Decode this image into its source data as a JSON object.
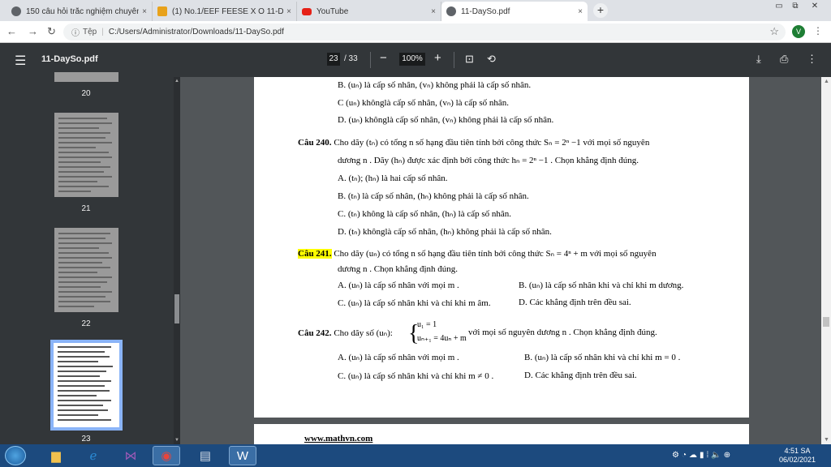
{
  "tabs": [
    {
      "title": "150 câu hỏi trắc nghiệm chuyên",
      "close": "×"
    },
    {
      "title": "(1) No.1/EEF FEESE X O 11-DaySo",
      "close": "×"
    },
    {
      "title": "YouTube",
      "close": "×"
    },
    {
      "title": "11-DaySo.pdf",
      "close": "×"
    }
  ],
  "new_tab": "+",
  "window_controls": {
    "minimize": "▭",
    "restore": "⧉",
    "close": "✕"
  },
  "address": {
    "scheme": "Tệp",
    "url": "C:/Users/Administrator/Downloads/11-DaySo.pdf"
  },
  "profile_initial": "V",
  "viewer": {
    "file_name": "11-DaySo.pdf",
    "current_page": "23",
    "total_pages": "/ 33",
    "zoom": "100%"
  },
  "thumbnails": [
    {
      "page": "20"
    },
    {
      "page": "21"
    },
    {
      "page": "22"
    },
    {
      "page": "23"
    }
  ],
  "content": {
    "l1": "B. (uₙ) là cấp số nhân, (vₙ) không phải là cấp số nhân.",
    "l2": "C (uₙ) khônglà cấp số nhân, (vₙ) là cấp số nhân.",
    "l3": "D. (uₙ) khônglà cấp số nhân, (vₙ) không phải là cấp số nhân.",
    "q240_label": "Câu 240.",
    "q240_text": "Cho dãy (tₙ) có tổng n số hạng đầu tiên tính bởi công thức Sₙ = 2ⁿ −1 với mọi số nguyên",
    "q240_text2": "dương n . Dãy (hₙ) được xác định bởi công thức hₙ = 2ⁿ −1 . Chọn khẳng định đúng.",
    "q240_a": "A. (tₙ); (hₙ) là hai cấp số nhân.",
    "q240_b": "B. (tₙ) là cấp số nhân, (hₙ) không phải là cấp số nhân.",
    "q240_c": "C. (tₙ) không là cấp số nhân, (hₙ) là cấp số nhân.",
    "q240_d": "D. (tₙ) khônglà cấp số nhân, (hₙ) không phải là cấp số nhân.",
    "q241_label": "Câu 241.",
    "q241_text": "Cho dãy (uₙ) có tổng n số hạng đầu tiên tính bởi công thức Sₙ = 4ⁿ + m với mọi số nguyên",
    "q241_text2": "dương n . Chọn khẳng định đúng.",
    "q241_a": "A. (uₙ) là cấp số nhân với mọi m .",
    "q241_b": "B. (uₙ) là cấp số nhân khi và chỉ khi m dương.",
    "q241_c": "C. (uₙ) là cấp số nhân khi và chỉ khi m âm.",
    "q241_d": "D. Các khẳng định trên đều sai.",
    "q242_label": "Câu 242.",
    "q242_text": "Cho dãy số (uₙ):",
    "q242_sys1": "u₁ = 1",
    "q242_sys2": "uₙ₊₁ = 4uₙ + m",
    "q242_text2": "với mọi số nguyên dương n . Chọn khẳng định đúng.",
    "q242_a": "A. (uₙ) là cấp số nhân với mọi m .",
    "q242_b": "B. (uₙ) là cấp số nhân khi và chỉ khi m = 0 .",
    "q242_c": "C. (uₙ) là cấp số nhân khi và chỉ khi m ≠ 0 .",
    "q242_d": "D. Các khẳng định trên đều sai.",
    "footer": "www.mathvn.com"
  },
  "clock": {
    "time": "4:51 SA",
    "date": "06/02/2021"
  }
}
